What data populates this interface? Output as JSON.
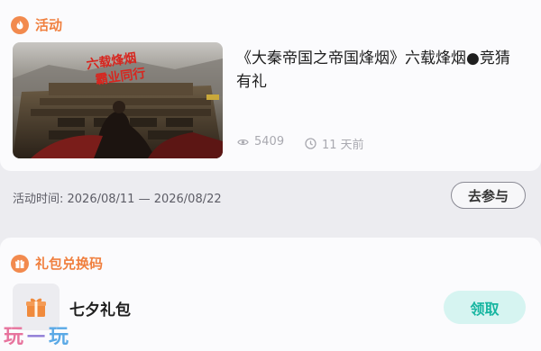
{
  "activity": {
    "section_title": "活动",
    "news_title": "《大秦帝国之帝国烽烟》六载烽烟●竞猜有礼",
    "banner_text": [
      "六载烽烟",
      "霸业同行"
    ],
    "views": "5409",
    "time_ago": "11 天前",
    "event_time": "活动时间: 2026/08/11 — 2026/08/22",
    "join_label": "去参与"
  },
  "gift": {
    "section_title": "礼包兑换码",
    "item_name": "七夕礼包",
    "claim_label": "领取"
  },
  "watermark": {
    "chars": [
      "玩",
      "一",
      "玩"
    ]
  },
  "colors": {
    "accent_orange": "#f07f3e",
    "claim_teal": "#16b5a0",
    "claim_bg": "#d6f4f1",
    "page_bg": "#ececf0"
  }
}
